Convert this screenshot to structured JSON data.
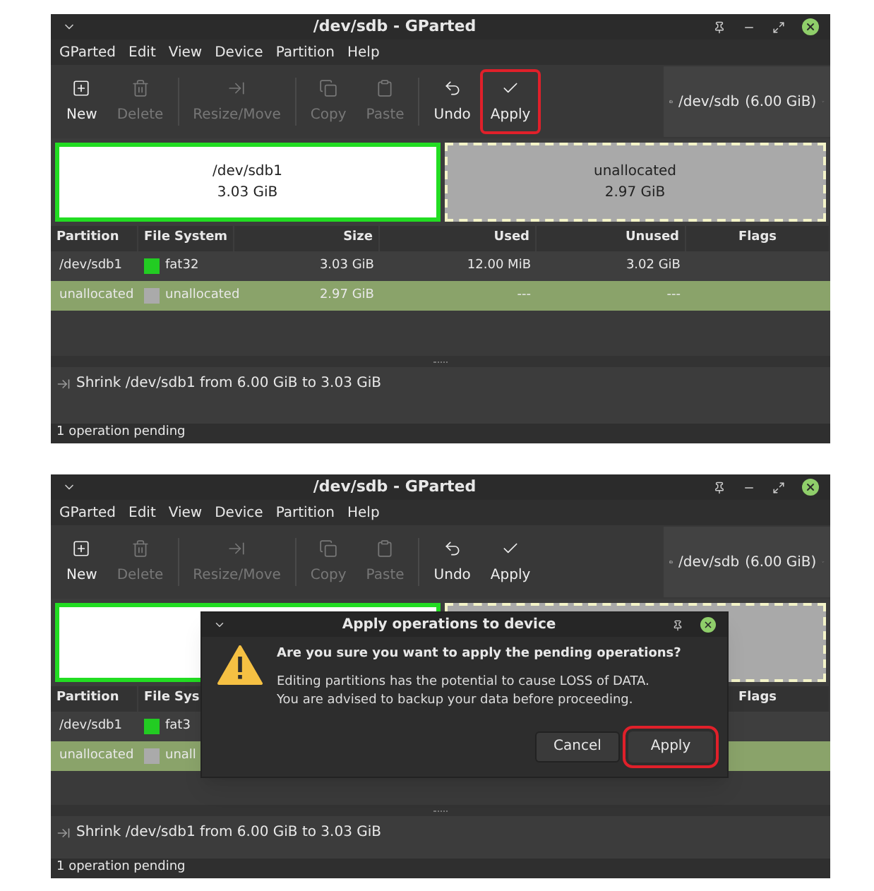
{
  "screenshots": [
    {
      "window": {
        "title": "/dev/sdb - GParted"
      },
      "menu": [
        "GParted",
        "Edit",
        "View",
        "Device",
        "Partition",
        "Help"
      ],
      "toolbar": [
        {
          "label": "New",
          "disabled": false,
          "highlighted": false
        },
        {
          "label": "Delete",
          "disabled": true,
          "highlighted": false
        },
        {
          "label": "Resize/Move",
          "disabled": true,
          "highlighted": false
        },
        {
          "label": "Copy",
          "disabled": true,
          "highlighted": false
        },
        {
          "label": "Paste",
          "disabled": true,
          "highlighted": false
        },
        {
          "label": "Undo",
          "disabled": false,
          "highlighted": false
        },
        {
          "label": "Apply",
          "disabled": false,
          "highlighted": true
        }
      ],
      "device": {
        "name": "/dev/sdb",
        "size": "(6.00 GiB)"
      },
      "graphic": [
        {
          "kind": "partition",
          "name": "/dev/sdb1",
          "size": "3.03 GiB"
        },
        {
          "kind": "unallocated",
          "name": "unallocated",
          "size": "2.97 GiB"
        }
      ],
      "table": {
        "columns": [
          {
            "kind": "partition",
            "label": "Partition"
          },
          {
            "kind": "filesystem",
            "label": "File System"
          },
          {
            "kind": "size",
            "label": "Size"
          },
          {
            "kind": "used",
            "label": "Used"
          },
          {
            "kind": "unused",
            "label": "Unused"
          },
          {
            "kind": "flags",
            "label": "Flags"
          }
        ],
        "rows": [
          {
            "selected": false,
            "color": "#22cc22",
            "cells": [
              {
                "kind": "partition",
                "text": "/dev/sdb1"
              },
              {
                "kind": "filesystem",
                "text": "fat32"
              },
              {
                "kind": "size",
                "text": "3.03 GiB"
              },
              {
                "kind": "used",
                "text": "12.00 MiB"
              },
              {
                "kind": "unused",
                "text": "3.02 GiB"
              }
            ]
          },
          {
            "selected": true,
            "color": "#aaaaaa",
            "cells": [
              {
                "kind": "partition",
                "text": "unallocated"
              },
              {
                "kind": "filesystem",
                "text": "unallocated"
              },
              {
                "kind": "size",
                "text": "2.97 GiB"
              },
              {
                "kind": "used",
                "text": "---"
              },
              {
                "kind": "unused",
                "text": "---"
              }
            ]
          }
        ]
      },
      "log": [
        "Shrink /dev/sdb1 from 6.00 GiB to 3.03 GiB"
      ],
      "status_bar": "1 operation pending"
    },
    {
      "window": {
        "title": "/dev/sdb - GParted"
      },
      "menu": [
        "GParted",
        "Edit",
        "View",
        "Device",
        "Partition",
        "Help"
      ],
      "toolbar": [
        {
          "label": "New",
          "disabled": false,
          "highlighted": false
        },
        {
          "label": "Delete",
          "disabled": true,
          "highlighted": false
        },
        {
          "label": "Resize/Move",
          "disabled": true,
          "highlighted": false
        },
        {
          "label": "Copy",
          "disabled": true,
          "highlighted": false
        },
        {
          "label": "Paste",
          "disabled": true,
          "highlighted": false
        },
        {
          "label": "Undo",
          "disabled": false,
          "highlighted": false
        },
        {
          "label": "Apply",
          "disabled": false,
          "highlighted": false
        }
      ],
      "device": {
        "name": "/dev/sdb",
        "size": "(6.00 GiB)"
      },
      "graphic": [
        {
          "kind": "partition"
        },
        {
          "kind": "unallocated"
        }
      ],
      "table": {
        "columns": [
          {
            "kind": "partition",
            "label": "Partition"
          },
          {
            "kind": "filesystem",
            "label": "File Sys"
          },
          {
            "kind": "flags",
            "label": "Flags"
          }
        ],
        "rows": [
          {
            "selected": false,
            "color": "#22cc22",
            "cells": [
              {
                "kind": "partition",
                "text": "/dev/sdb1"
              },
              {
                "kind": "filesystem",
                "text": "fat3"
              }
            ]
          },
          {
            "selected": true,
            "color": "#aaaaaa",
            "cells": [
              {
                "kind": "partition",
                "text": "unallocated"
              },
              {
                "kind": "filesystem",
                "text": "unall"
              }
            ]
          }
        ]
      },
      "log": [
        "Shrink /dev/sdb1 from 6.00 GiB to 3.03 GiB"
      ],
      "status_bar": "1 operation pending",
      "dialog": {
        "title": "Apply operations to device",
        "heading": "Are you sure you want to apply the pending operations?",
        "body": [
          "Editing partitions has the potential to cause LOSS of DATA.",
          "You are advised to backup your data before proceeding."
        ],
        "buttons": [
          {
            "label": "Cancel",
            "highlighted": false
          },
          {
            "label": "Apply",
            "highlighted": true
          }
        ]
      }
    }
  ]
}
